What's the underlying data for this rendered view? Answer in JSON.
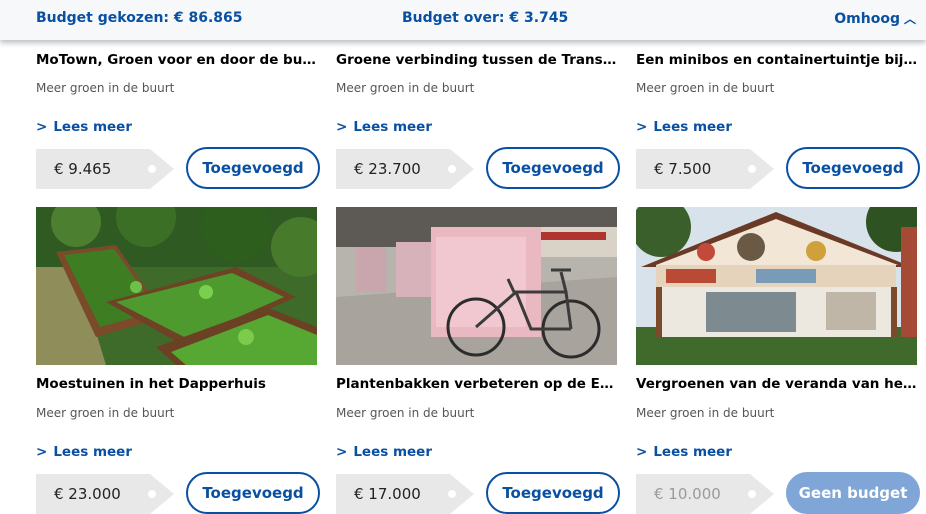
{
  "topbar": {
    "budget_chosen": "Budget gekozen: € 86.865",
    "budget_left": "Budget over: € 3.745",
    "scroll_up": "Omhoog",
    "scroll_up_icon": "chevron-up-icon"
  },
  "row1": [
    {
      "title": "MoTown, Groen voor en door de buurt",
      "category": "Meer groen in de buurt",
      "more": "Lees meer",
      "price": "€ 9.465",
      "button": "Toegevoegd"
    },
    {
      "title": "Groene verbinding tussen de Transv...",
      "category": "Meer groen in de buurt",
      "more": "Lees meer",
      "price": "€ 23.700",
      "button": "Toegevoegd"
    },
    {
      "title": "Een minibos en containertuintje bij ...",
      "category": "Meer groen in de buurt",
      "more": "Lees meer",
      "price": "€ 7.500",
      "button": "Toegevoegd"
    }
  ],
  "row2": [
    {
      "title": "Moestuinen in het Dapperhuis",
      "category": "Meer groen in de buurt",
      "more": "Lees meer",
      "price": "€ 23.000",
      "button": "Toegevoegd",
      "image": "raised-vegetable-beds-photo"
    },
    {
      "title": "Plantenbakken verbeteren op de Ee...",
      "category": "Meer groen in de buurt",
      "more": "Lees meer",
      "price": "€ 17.000",
      "button": "Toegevoegd",
      "image": "bicycle-planters-photo"
    },
    {
      "title": "Vergroenen van de veranda van het ...",
      "category": "Meer groen in de buurt",
      "more": "Lees meer",
      "price": "€ 10.000",
      "button": "Geen budget",
      "image": "painted-pavilion-photo"
    }
  ],
  "colors": {
    "accent": "#0a50a2",
    "disabled_button": "#7fa6d7",
    "price_bg": "#e8e8e8"
  }
}
